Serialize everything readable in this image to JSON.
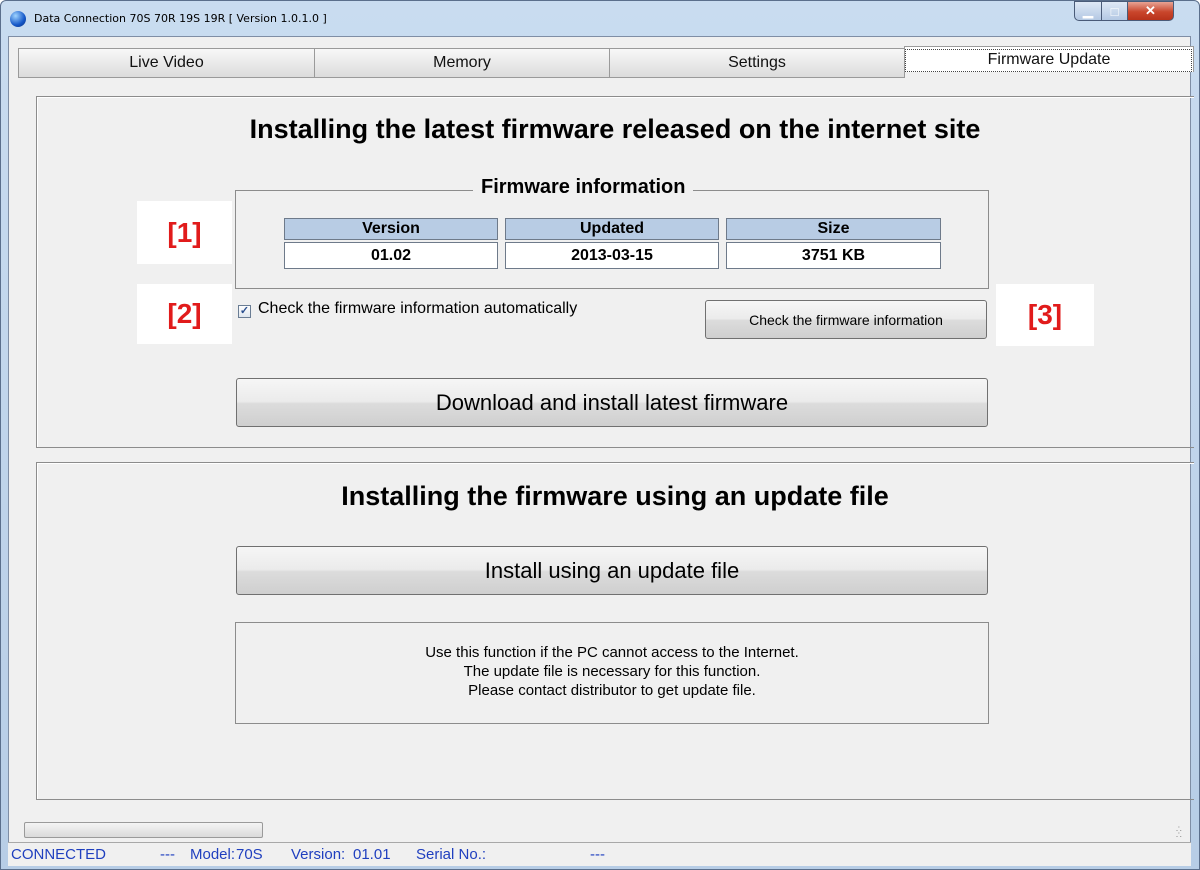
{
  "window": {
    "title": "Data Connection 70S 70R 19S 19R   [ Version 1.0.1.0 ]",
    "min_glyph": "▁",
    "max_glyph": "□",
    "close_glyph": "✕"
  },
  "tabs": [
    {
      "label": "Live Video",
      "active": false
    },
    {
      "label": "Memory",
      "active": false
    },
    {
      "label": "Settings",
      "active": false
    },
    {
      "label": "Firmware Update",
      "active": true
    }
  ],
  "online": {
    "heading": "Installing the latest firmware released on the internet site",
    "group_title": "Firmware information",
    "columns": [
      "Version",
      "Updated",
      "Size"
    ],
    "values": [
      "01.02",
      "2013-03-15",
      "3751 KB"
    ],
    "auto_check_label": "Check the firmware information automatically",
    "auto_check_checked": true,
    "check_button": "Check the firmware information",
    "download_button": "Download and install latest firmware"
  },
  "offline": {
    "heading": "Installing the firmware using an update file",
    "install_button": "Install using an update file",
    "note_lines": [
      "Use this function if the PC cannot access to the Internet.",
      "The update file is necessary for this function.",
      "Please contact distributor to get update file."
    ]
  },
  "markers": [
    "[1]",
    "[2]",
    "[3]"
  ],
  "status": {
    "connection": "CONNECTED",
    "separator": "---",
    "model_label": "Model:",
    "model": "70S",
    "version_label": "Version:",
    "version": "01.01",
    "serial_label": "Serial No.:",
    "serial_value": "---"
  },
  "colors": {
    "marker": "#e11b1b",
    "header_fill": "#b8cce4",
    "status_text": "#1f3fbf"
  }
}
